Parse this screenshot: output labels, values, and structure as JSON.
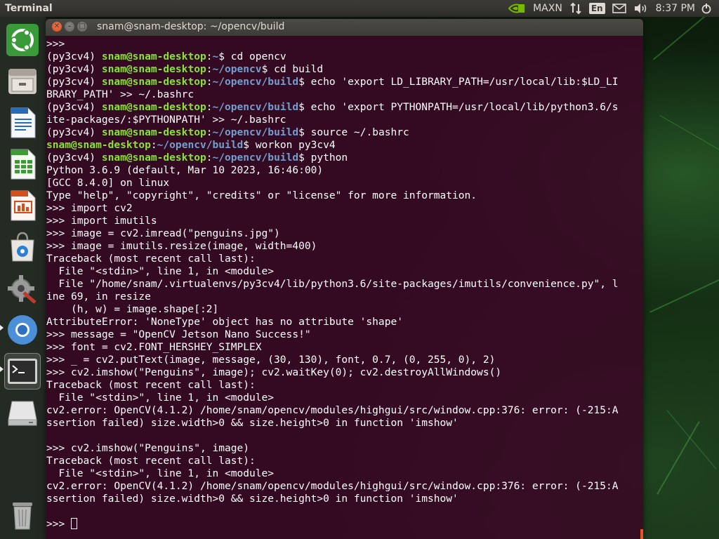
{
  "top_panel": {
    "app_title": "Terminal",
    "power_mode": "MAXN",
    "keyboard_layout": "En",
    "clock": "8:37 PM"
  },
  "launcher": {
    "items": [
      {
        "name": "ubuntu-dash-icon"
      },
      {
        "name": "files-icon"
      },
      {
        "name": "libreoffice-writer-icon"
      },
      {
        "name": "libreoffice-calc-icon"
      },
      {
        "name": "libreoffice-impress-icon"
      },
      {
        "name": "software-center-icon"
      },
      {
        "name": "system-settings-icon"
      },
      {
        "name": "chromium-icon"
      },
      {
        "name": "terminal-icon"
      },
      {
        "name": "drive-icon"
      },
      {
        "name": "trash-icon"
      }
    ]
  },
  "window": {
    "title": "snam@snam-desktop: ~/opencv/build"
  },
  "terminal": {
    "lines": [
      [
        {
          "t": ">>>"
        }
      ],
      [
        {
          "t": "(py3cv4) "
        },
        {
          "t": "snam@snam-desktop",
          "c": "g"
        },
        {
          "t": ":"
        },
        {
          "t": "~",
          "c": "b"
        },
        {
          "t": "$ cd opencv"
        }
      ],
      [
        {
          "t": "(py3cv4) "
        },
        {
          "t": "snam@snam-desktop",
          "c": "g"
        },
        {
          "t": ":"
        },
        {
          "t": "~/opencv",
          "c": "b"
        },
        {
          "t": "$ cd build"
        }
      ],
      [
        {
          "t": "(py3cv4) "
        },
        {
          "t": "snam@snam-desktop",
          "c": "g"
        },
        {
          "t": ":"
        },
        {
          "t": "~/opencv/build",
          "c": "b"
        },
        {
          "t": "$ echo 'export LD_LIBRARY_PATH=/usr/local/lib:$LD_LI"
        }
      ],
      [
        {
          "t": "BRARY_PATH' >> ~/.bashrc"
        }
      ],
      [
        {
          "t": "(py3cv4) "
        },
        {
          "t": "snam@snam-desktop",
          "c": "g"
        },
        {
          "t": ":"
        },
        {
          "t": "~/opencv/build",
          "c": "b"
        },
        {
          "t": "$ echo 'export PYTHONPATH=/usr/local/lib/python3.6/s"
        }
      ],
      [
        {
          "t": "ite-packages/:$PYTHONPATH' >> ~/.bashrc"
        }
      ],
      [
        {
          "t": "(py3cv4) "
        },
        {
          "t": "snam@snam-desktop",
          "c": "g"
        },
        {
          "t": ":"
        },
        {
          "t": "~/opencv/build",
          "c": "b"
        },
        {
          "t": "$ source ~/.bashrc"
        }
      ],
      [
        {
          "t": "snam@snam-desktop",
          "c": "g"
        },
        {
          "t": ":"
        },
        {
          "t": "~/opencv/build",
          "c": "b"
        },
        {
          "t": "$ workon py3cv4"
        }
      ],
      [
        {
          "t": "(py3cv4) "
        },
        {
          "t": "snam@snam-desktop",
          "c": "g"
        },
        {
          "t": ":"
        },
        {
          "t": "~/opencv/build",
          "c": "b"
        },
        {
          "t": "$ python"
        }
      ],
      [
        {
          "t": "Python 3.6.9 (default, Mar 10 2023, 16:46:00)"
        }
      ],
      [
        {
          "t": "[GCC 8.4.0] on linux"
        }
      ],
      [
        {
          "t": "Type \"help\", \"copyright\", \"credits\" or \"license\" for more information."
        }
      ],
      [
        {
          "t": ">>> import cv2"
        }
      ],
      [
        {
          "t": ">>> import imutils"
        }
      ],
      [
        {
          "t": ">>> image = cv2.imread(\"penguins.jpg\")"
        }
      ],
      [
        {
          "t": ">>> image = imutils.resize(image, width=400)"
        }
      ],
      [
        {
          "t": "Traceback (most recent call last):"
        }
      ],
      [
        {
          "t": "  File \"<stdin>\", line 1, in <module>"
        }
      ],
      [
        {
          "t": "  File \"/home/snam/.virtualenvs/py3cv4/lib/python3.6/site-packages/imutils/convenience.py\", l"
        }
      ],
      [
        {
          "t": "ine 69, in resize"
        }
      ],
      [
        {
          "t": "    (h, w) = image.shape[:2]"
        }
      ],
      [
        {
          "t": "AttributeError: 'NoneType' object has no attribute 'shape'"
        }
      ],
      [
        {
          "t": ">>> message = \"OpenCV Jetson Nano Success!\""
        }
      ],
      [
        {
          "t": ">>> font = cv2.FONT_HERSHEY_SIMPLEX"
        }
      ],
      [
        {
          "t": ">>> _ = cv2.putText(image, message, (30, 130), font, 0.7, (0, 255, 0), 2)"
        }
      ],
      [
        {
          "t": ">>> cv2.imshow(\"Penguins\", image); cv2.waitKey(0); cv2.destroyAllWindows()"
        }
      ],
      [
        {
          "t": "Traceback (most recent call last):"
        }
      ],
      [
        {
          "t": "  File \"<stdin>\", line 1, in <module>"
        }
      ],
      [
        {
          "t": "cv2.error: OpenCV(4.1.2) /home/snam/opencv/modules/highgui/src/window.cpp:376: error: (-215:A"
        }
      ],
      [
        {
          "t": "ssertion failed) size.width>0 && size.height>0 in function 'imshow'"
        }
      ],
      [
        {
          "t": ""
        }
      ],
      [
        {
          "t": ">>> cv2.imshow(\"Penguins\", image)"
        }
      ],
      [
        {
          "t": "Traceback (most recent call last):"
        }
      ],
      [
        {
          "t": "  File \"<stdin>\", line 1, in <module>"
        }
      ],
      [
        {
          "t": "cv2.error: OpenCV(4.1.2) /home/snam/opencv/modules/highgui/src/window.cpp:376: error: (-215:A"
        }
      ],
      [
        {
          "t": "ssertion failed) size.width>0 && size.height>0 in function 'imshow'"
        }
      ],
      [
        {
          "t": ""
        }
      ]
    ],
    "prompt": ">>> "
  }
}
